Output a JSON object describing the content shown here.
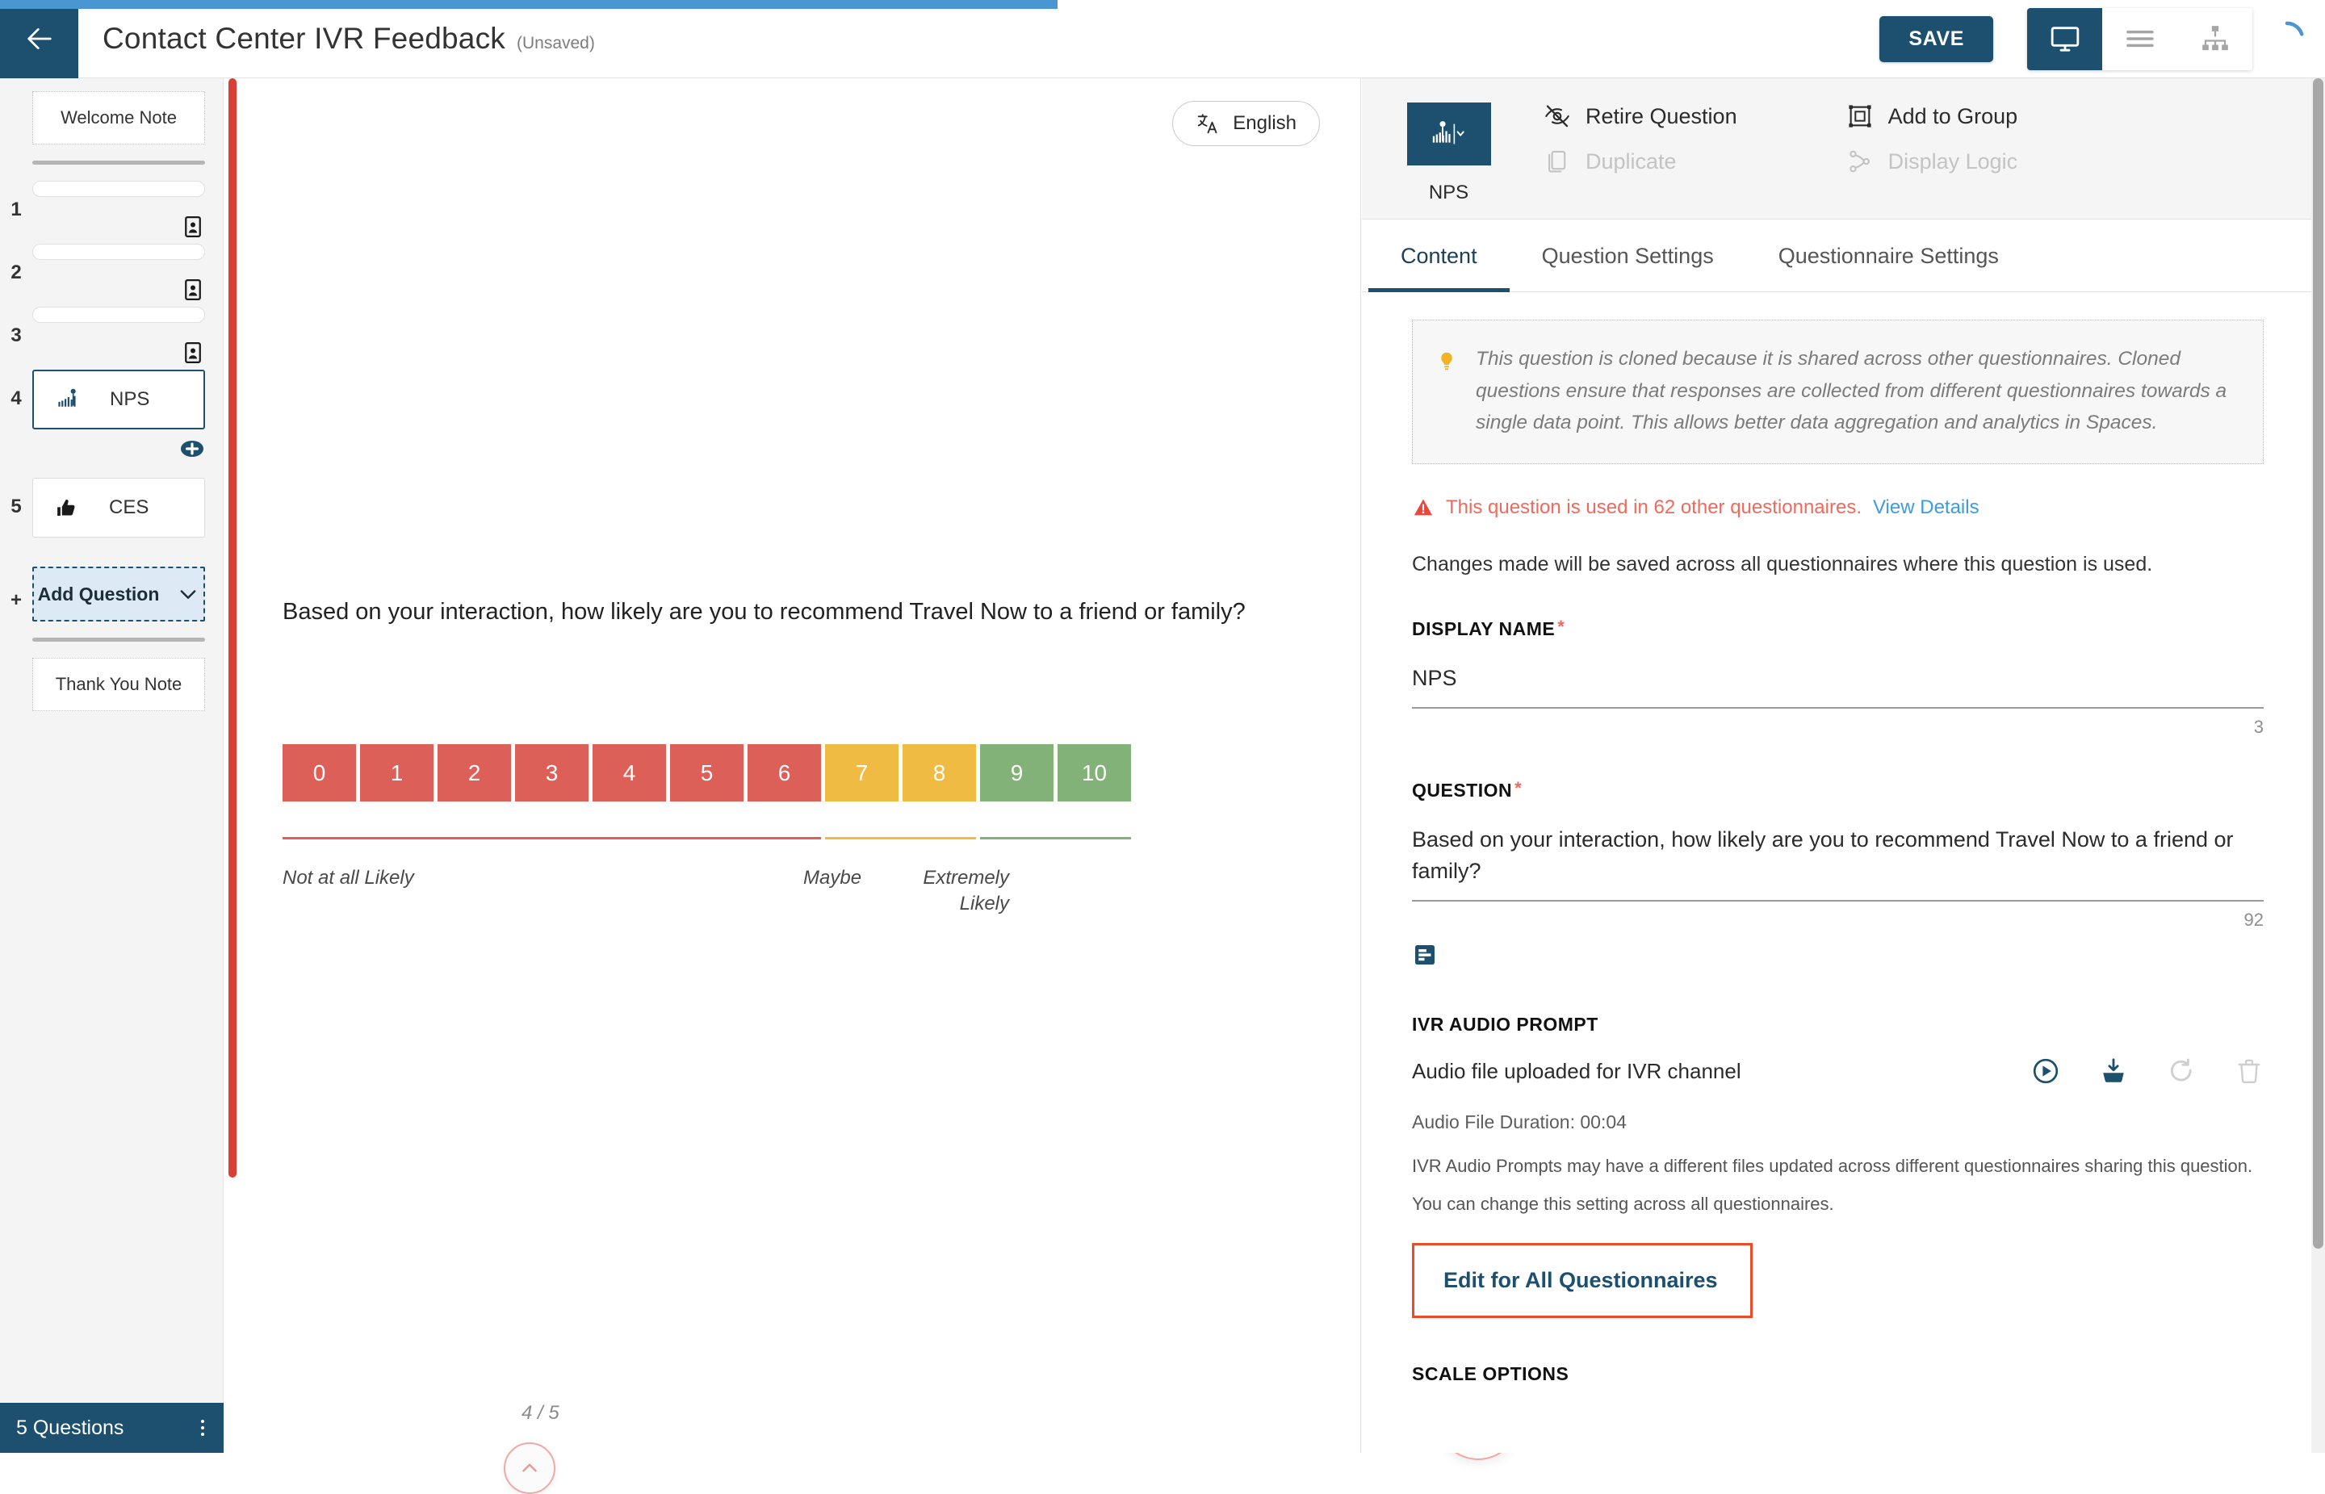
{
  "header": {
    "back_icon": "arrow-left-icon",
    "title": "Contact Center IVR Feedback",
    "unsaved_label": "(Unsaved)",
    "save_label": "SAVE",
    "view_toggle": [
      {
        "icon": "desktop-preview-icon",
        "active": true
      },
      {
        "icon": "list-view-icon",
        "active": false
      },
      {
        "icon": "tree-view-icon",
        "active": false
      }
    ],
    "loading_spinner_icon": "loading-spinner-icon"
  },
  "sidebar": {
    "welcome_note": "Welcome Note",
    "thank_you_note": "Thank You Note",
    "items": [
      {
        "number": "1",
        "label": "",
        "type": "collapsed",
        "icon": "contact-card-icon"
      },
      {
        "number": "2",
        "label": "",
        "type": "collapsed",
        "icon": "contact-card-icon"
      },
      {
        "number": "3",
        "label": "",
        "type": "collapsed",
        "icon": "contact-card-icon"
      },
      {
        "number": "4",
        "label": "NPS",
        "type": "card",
        "icon": "nps-chart-icon",
        "selected": true
      },
      {
        "number": "5",
        "label": "CES",
        "type": "card",
        "icon": "thumbs-up-icon",
        "selected": false
      }
    ],
    "add_question": {
      "plus": "+",
      "label": "Add Question",
      "chevron_icon": "chevron-down-icon"
    },
    "status": {
      "text": "5 Questions",
      "menu_icon": "kebab-menu-icon"
    }
  },
  "preview": {
    "language": {
      "icon": "translate-icon",
      "label": "English"
    },
    "question_text": "Based on your interaction, how likely are you to recommend Travel Now to a friend or family?",
    "page_indicator": "4 / 5",
    "nav_up_icon": "chevron-up-icon",
    "nav_down_icon": "chevron-down-icon",
    "labels": {
      "left": "Not at all Likely",
      "middle": "Maybe",
      "right": "Extremely Likely"
    },
    "colors": {
      "detractor": "#dd6058",
      "passive": "#f0bb42",
      "promoter": "#83b278"
    },
    "scale": [
      {
        "value": "0",
        "group": "detractor"
      },
      {
        "value": "1",
        "group": "detractor"
      },
      {
        "value": "2",
        "group": "detractor"
      },
      {
        "value": "3",
        "group": "detractor"
      },
      {
        "value": "4",
        "group": "detractor"
      },
      {
        "value": "5",
        "group": "detractor"
      },
      {
        "value": "6",
        "group": "detractor"
      },
      {
        "value": "7",
        "group": "passive"
      },
      {
        "value": "8",
        "group": "passive"
      },
      {
        "value": "9",
        "group": "promoter"
      },
      {
        "value": "10",
        "group": "promoter"
      }
    ]
  },
  "right_panel": {
    "question_type": {
      "icon": "nps-chart-icon",
      "chevron_icon": "chevron-down-icon",
      "label": "NPS"
    },
    "actions": [
      {
        "label": "Retire Question",
        "icon": "eye-off-icon",
        "enabled": true
      },
      {
        "label": "Add to Group",
        "icon": "group-box-icon",
        "enabled": true
      },
      {
        "label": "Duplicate",
        "icon": "duplicate-icon",
        "enabled": false
      },
      {
        "label": "Display Logic",
        "icon": "branch-logic-icon",
        "enabled": false
      }
    ],
    "tabs": [
      {
        "label": "Content",
        "active": true
      },
      {
        "label": "Question Settings",
        "active": false
      },
      {
        "label": "Questionnaire Settings",
        "active": false
      }
    ],
    "clone_note": {
      "icon": "lightbulb-icon",
      "text": "This question is cloned because it is shared across other questionnaires. Cloned questions ensure that responses are collected from different questionnaires towards a single data point. This allows better data aggregation and analytics in Spaces."
    },
    "usage_warning": {
      "icon": "warning-triangle-icon",
      "text": "This question is used in 62 other questionnaires.",
      "link": "View Details"
    },
    "changes_note": "Changes made will be saved across all questionnaires where this question is used.",
    "display_name": {
      "label": "DISPLAY NAME",
      "required": "*",
      "value": "NPS",
      "char_count": "3"
    },
    "question": {
      "label": "QUESTION",
      "required": "*",
      "value": "Based on your interaction, how likely are you to recommend Travel Now to a friend or family?",
      "char_count": "92",
      "format_icon": "text-format-icon"
    },
    "ivr_audio_prompt": {
      "label": "IVR AUDIO PROMPT",
      "file_name": "Audio file uploaded for IVR channel",
      "duration": "Audio File Duration: 00:04",
      "help_line_1": "IVR Audio Prompts may have a different files updated across different questionnaires sharing this question.",
      "help_line_2": "You can change this setting across all questionnaires.",
      "actions": [
        {
          "icon": "play-icon",
          "enabled": true
        },
        {
          "icon": "upload-icon",
          "enabled": true
        },
        {
          "icon": "refresh-icon",
          "enabled": false
        },
        {
          "icon": "trash-icon",
          "enabled": false
        }
      ],
      "edit_all_label": "Edit for All Questionnaires"
    },
    "scale_options_label": "SCALE OPTIONS"
  }
}
